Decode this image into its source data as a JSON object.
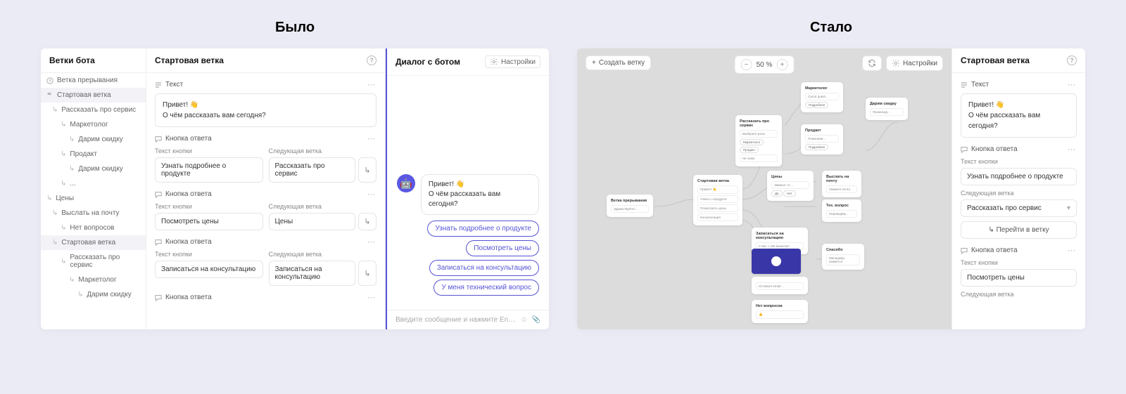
{
  "labels": {
    "before": "Было",
    "after": "Стало"
  },
  "left": {
    "branches_title": "Ветки бота",
    "branches": [
      {
        "label": "Ветка прерывания",
        "icon": "clock",
        "level": 0
      },
      {
        "label": "Стартовая ветка",
        "icon": "flag",
        "level": 0,
        "selected": true
      },
      {
        "label": "Рассказать про сервис",
        "level": 1
      },
      {
        "label": "Маркетолог",
        "level": 2
      },
      {
        "label": "Дарим скидку",
        "level": 3
      },
      {
        "label": "Продакт",
        "level": 2
      },
      {
        "label": "Дарим скидку",
        "level": 3
      },
      {
        "label": "...",
        "level": 2
      },
      {
        "label": "Цены",
        "level": 0
      },
      {
        "label": "Выслать на почту",
        "level": 1
      },
      {
        "label": "Нет вопросов",
        "level": 2
      },
      {
        "label": "Стартовая ветка",
        "level": 1,
        "selected": true
      },
      {
        "label": "Рассказать про сервис",
        "level": 2
      },
      {
        "label": "Маркетолог",
        "level": 3
      },
      {
        "label": "Дарим скидку",
        "level": 4
      }
    ],
    "editor_title": "Стартовая ветка",
    "text_block_label": "Текст",
    "greeting_l1": "Привет! 👋",
    "greeting_l2": "О чём рассказать вам сегодня?",
    "button_block_label": "Кнопка ответа",
    "field_button_text": "Текст кнопки",
    "field_next_branch": "Следующая ветка",
    "buttons": [
      {
        "text": "Узнать подробнее о продукте",
        "next": "Рассказать про сервис"
      },
      {
        "text": "Посмотреть цены",
        "next": "Цены"
      },
      {
        "text": "Записаться на консультацию",
        "next": "Записаться на консультацию"
      }
    ],
    "chat_title": "Диалог с ботом",
    "settings_label": "Настройки",
    "chat_options": [
      "Узнать подробнее о продукте",
      "Посмотреть цены",
      "Записаться на консультацию",
      "У меня технический вопрос"
    ],
    "chat_placeholder": "Введите сообщение и нажмите En…"
  },
  "right": {
    "create_branch": "Создать ветку",
    "zoom": "50 %",
    "settings_label": "Настройки",
    "editor_title": "Стартовая ветка",
    "text_block_label": "Текст",
    "greeting_l1": "Привет! 👋",
    "greeting_l2": "О чём рассказать вам сегодня?",
    "button_block_label": "Кнопка ответа",
    "field_button_text": "Текст кнопки",
    "field_next_branch": "Следующая ветка",
    "btn1_text": "Узнать подробнее о продукте",
    "btn1_next": "Рассказать про сервис",
    "goto_branch": "Перейти в ветку",
    "btn2_text": "Посмотреть цены",
    "nodes": {
      "interrupt": "Ветка прерывания",
      "start": "Стартовая ветка",
      "service": "Рассказать про сервис",
      "marketer": "Маркетолог",
      "product": "Продакт",
      "discount": "Дарим скидку",
      "prices": "Цены",
      "mail": "Выслать на почту",
      "tech": "Тех. вопрос",
      "consult": "Записаться на консультацию",
      "thanks": "Спасибо",
      "noq": "Нет вопросов"
    }
  }
}
